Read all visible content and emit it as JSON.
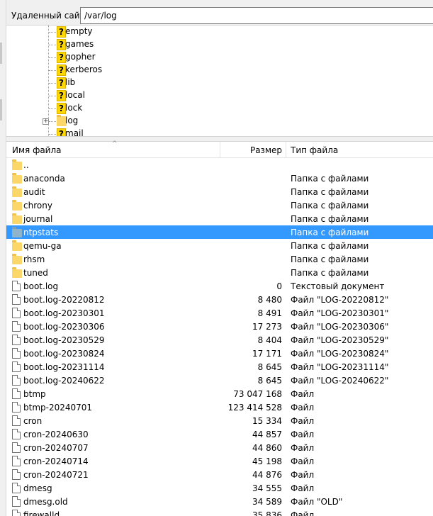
{
  "address": {
    "label": "Удаленный сайт:",
    "path": "/var/log"
  },
  "tree": {
    "items": [
      {
        "label": "empty",
        "icon": "unknown-folder-icon"
      },
      {
        "label": "games",
        "icon": "unknown-folder-icon"
      },
      {
        "label": "gopher",
        "icon": "unknown-folder-icon"
      },
      {
        "label": "kerberos",
        "icon": "unknown-folder-icon"
      },
      {
        "label": "lib",
        "icon": "unknown-folder-icon"
      },
      {
        "label": "local",
        "icon": "unknown-folder-icon"
      },
      {
        "label": "lock",
        "icon": "unknown-folder-icon"
      },
      {
        "label": "log",
        "icon": "folder-icon",
        "expandable": true,
        "expander": "+"
      },
      {
        "label": "mail",
        "icon": "unknown-folder-icon"
      }
    ]
  },
  "columns": {
    "name": "Имя файла",
    "size": "Размер",
    "type": "Тип файла",
    "sort_indicator": "^"
  },
  "files": [
    {
      "name": "..",
      "size": "",
      "type": "",
      "kind": "folder"
    },
    {
      "name": "anaconda",
      "size": "",
      "type": "Папка с файлами",
      "kind": "folder"
    },
    {
      "name": "audit",
      "size": "",
      "type": "Папка с файлами",
      "kind": "folder"
    },
    {
      "name": "chrony",
      "size": "",
      "type": "Папка с файлами",
      "kind": "folder"
    },
    {
      "name": "journal",
      "size": "",
      "type": "Папка с файлами",
      "kind": "folder"
    },
    {
      "name": "ntpstats",
      "size": "",
      "type": "Папка с файлами",
      "kind": "folder",
      "selected": true
    },
    {
      "name": "qemu-ga",
      "size": "",
      "type": "Папка с файлами",
      "kind": "folder"
    },
    {
      "name": "rhsm",
      "size": "",
      "type": "Папка с файлами",
      "kind": "folder"
    },
    {
      "name": "tuned",
      "size": "",
      "type": "Папка с файлами",
      "kind": "folder"
    },
    {
      "name": "boot.log",
      "size": "0",
      "type": "Текстовый документ",
      "kind": "file"
    },
    {
      "name": "boot.log-20220812",
      "size": "8 480",
      "type": "Файл \"LOG-20220812\"",
      "kind": "file"
    },
    {
      "name": "boot.log-20230301",
      "size": "8 491",
      "type": "Файл \"LOG-20230301\"",
      "kind": "file"
    },
    {
      "name": "boot.log-20230306",
      "size": "17 273",
      "type": "Файл \"LOG-20230306\"",
      "kind": "file"
    },
    {
      "name": "boot.log-20230529",
      "size": "8 404",
      "type": "Файл \"LOG-20230529\"",
      "kind": "file"
    },
    {
      "name": "boot.log-20230824",
      "size": "17 171",
      "type": "Файл \"LOG-20230824\"",
      "kind": "file"
    },
    {
      "name": "boot.log-20231114",
      "size": "8 645",
      "type": "Файл \"LOG-20231114\"",
      "kind": "file"
    },
    {
      "name": "boot.log-20240622",
      "size": "8 645",
      "type": "Файл \"LOG-20240622\"",
      "kind": "file"
    },
    {
      "name": "btmp",
      "size": "73 047 168",
      "type": "Файл",
      "kind": "file"
    },
    {
      "name": "btmp-20240701",
      "size": "123 414 528",
      "type": "Файл",
      "kind": "file"
    },
    {
      "name": "cron",
      "size": "15 334",
      "type": "Файл",
      "kind": "file"
    },
    {
      "name": "cron-20240630",
      "size": "44 857",
      "type": "Файл",
      "kind": "file"
    },
    {
      "name": "cron-20240707",
      "size": "44 860",
      "type": "Файл",
      "kind": "file"
    },
    {
      "name": "cron-20240714",
      "size": "45 198",
      "type": "Файл",
      "kind": "file"
    },
    {
      "name": "cron-20240721",
      "size": "44 876",
      "type": "Файл",
      "kind": "file"
    },
    {
      "name": "dmesg",
      "size": "34 555",
      "type": "Файл",
      "kind": "file"
    },
    {
      "name": "dmesg.old",
      "size": "34 589",
      "type": "Файл \"OLD\"",
      "kind": "file"
    },
    {
      "name": "firewalld",
      "size": "35 836",
      "type": "Файл",
      "kind": "file"
    }
  ],
  "colors": {
    "selection": "#3399ff",
    "folder": "#fbd76a",
    "unknown": "#ffd800"
  }
}
